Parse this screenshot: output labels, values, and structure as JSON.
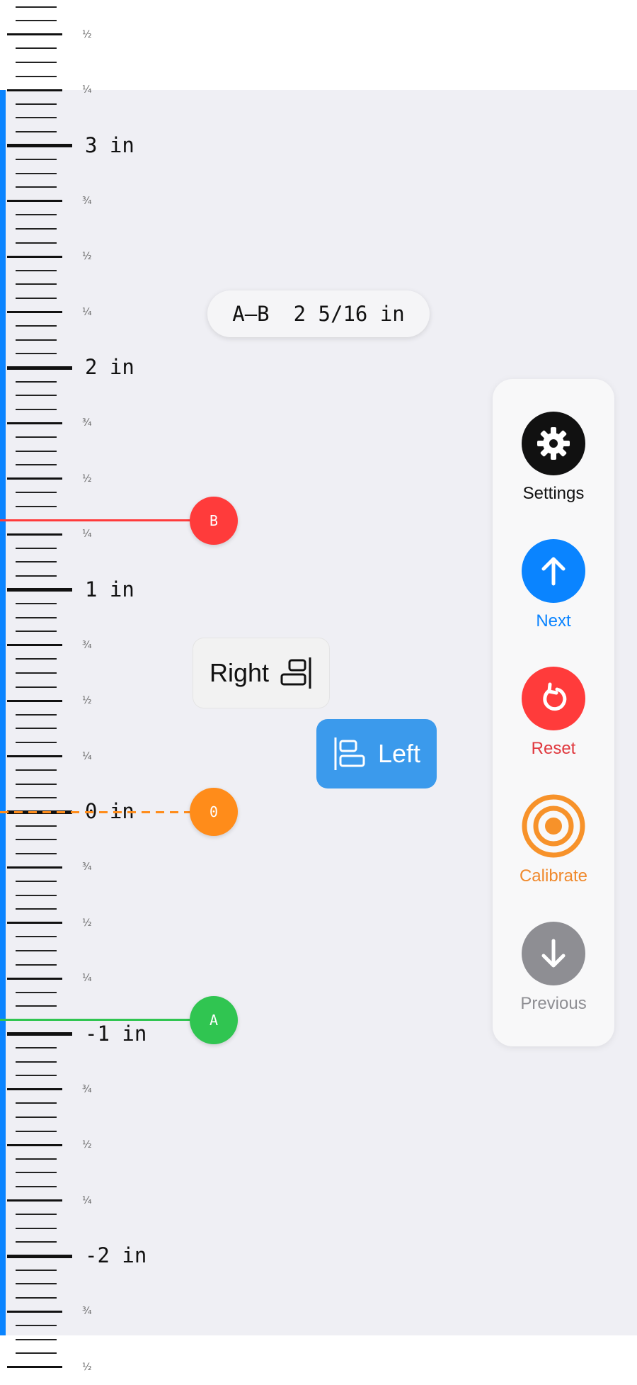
{
  "ruler": {
    "inch_labels": [
      {
        "value": 3,
        "text": "3 in"
      },
      {
        "value": 2,
        "text": "2 in"
      },
      {
        "value": 1,
        "text": "1 in"
      },
      {
        "value": 0,
        "text": "0 in"
      },
      {
        "value": -1,
        "text": "-1 in"
      },
      {
        "value": -2,
        "text": "-2 in"
      }
    ],
    "fraction_labels": [
      {
        "value": 3.5,
        "text": "½"
      },
      {
        "value": 3.25,
        "text": "¼"
      },
      {
        "value": 2.75,
        "text": "¾"
      },
      {
        "value": 2.5,
        "text": "½"
      },
      {
        "value": 2.25,
        "text": "¼"
      },
      {
        "value": 1.75,
        "text": "¾"
      },
      {
        "value": 1.5,
        "text": "½"
      },
      {
        "value": 1.25,
        "text": "¼"
      },
      {
        "value": 0.75,
        "text": "¾"
      },
      {
        "value": 0.5,
        "text": "½"
      },
      {
        "value": 0.25,
        "text": "¼"
      },
      {
        "value": -0.25,
        "text": "¾"
      },
      {
        "value": -0.5,
        "text": "½"
      },
      {
        "value": -0.75,
        "text": "¼"
      },
      {
        "value": -1.25,
        "text": "¾"
      },
      {
        "value": -1.5,
        "text": "½"
      },
      {
        "value": -1.75,
        "text": "¼"
      },
      {
        "value": -2.25,
        "text": "¾"
      },
      {
        "value": -2.5,
        "text": "½"
      }
    ]
  },
  "markers": {
    "b": {
      "label": "B",
      "value": 1.3125,
      "color": "#ff3b3b"
    },
    "zero": {
      "label": "0",
      "value": 0,
      "color": "#ff8c1a"
    },
    "a": {
      "label": "A",
      "value": -0.9375,
      "color": "#30c551"
    }
  },
  "measurement": {
    "name": "A—B",
    "value": "2 5/16 in"
  },
  "align_right": {
    "label": "Right",
    "icon": "align-right-icon"
  },
  "align_left": {
    "label": "Left",
    "icon": "align-left-icon"
  },
  "actions": [
    {
      "label": "Settings",
      "icon": "gear-icon",
      "circle_color": "#111111",
      "label_color": "#111111"
    },
    {
      "label": "Next",
      "icon": "arrow-up-icon",
      "circle_color": "#0a84ff",
      "label_color": "#0a84ff"
    },
    {
      "label": "Reset",
      "icon": "reset-icon",
      "circle_color": "#ff3b3b",
      "label_color": "#e0383e"
    },
    {
      "label": "Calibrate",
      "icon": "target-icon",
      "circle_color": "#f7922a",
      "label_color": "#f0892c"
    },
    {
      "label": "Previous",
      "icon": "arrow-down-icon",
      "circle_color": "#8e8e93",
      "label_color": "#8e8e93"
    }
  ]
}
